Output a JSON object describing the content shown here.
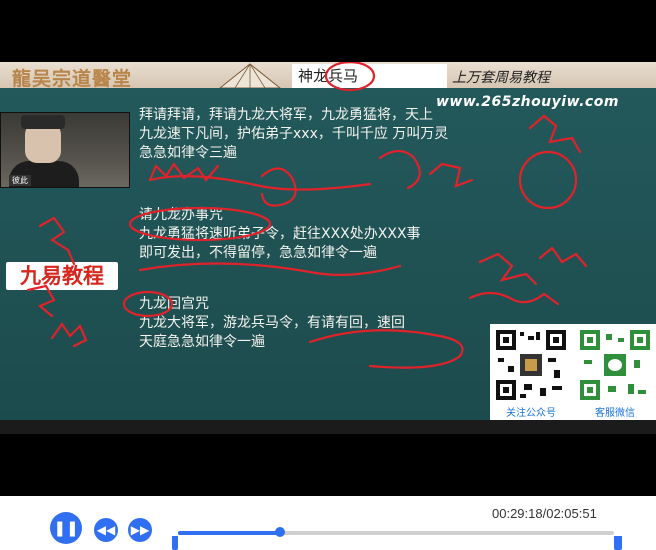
{
  "video": {
    "logo": "龍吴宗道醫堂",
    "title": "神龙兵马",
    "title_extra": "上万套周易教程",
    "watermark": "www.265zhouyiw.com",
    "brand_badge": "九易教程",
    "webcam_tag": "彼此"
  },
  "slides": {
    "block1": [
      "拜请拜请，拜请九龙大将军，九龙勇猛将，天上",
      "九龙速下凡间，护佑弟子xxx，千叫千应 万叫万灵",
      "急急如律令三遍"
    ],
    "block2": [
      "请九龙办事咒",
      "九龙勇猛将速听弟子令，赶往XXX处办XXX事",
      "即可发出，不得留停，急急如律令一遍"
    ],
    "block3": [
      "九龙回宫咒",
      "九龙大将军，游龙兵马令，有请有回，速回",
      "天庭急急如律令一遍"
    ]
  },
  "qr": {
    "label1": "关注公众号",
    "label2": "客服微信"
  },
  "player": {
    "time": "00:29:18/02:05:51",
    "progress": 0.234,
    "pause_icon": "❚❚",
    "rewind_icon": "◀◀",
    "forward_icon": "▶▶",
    "accent": "#2f6ff0"
  }
}
